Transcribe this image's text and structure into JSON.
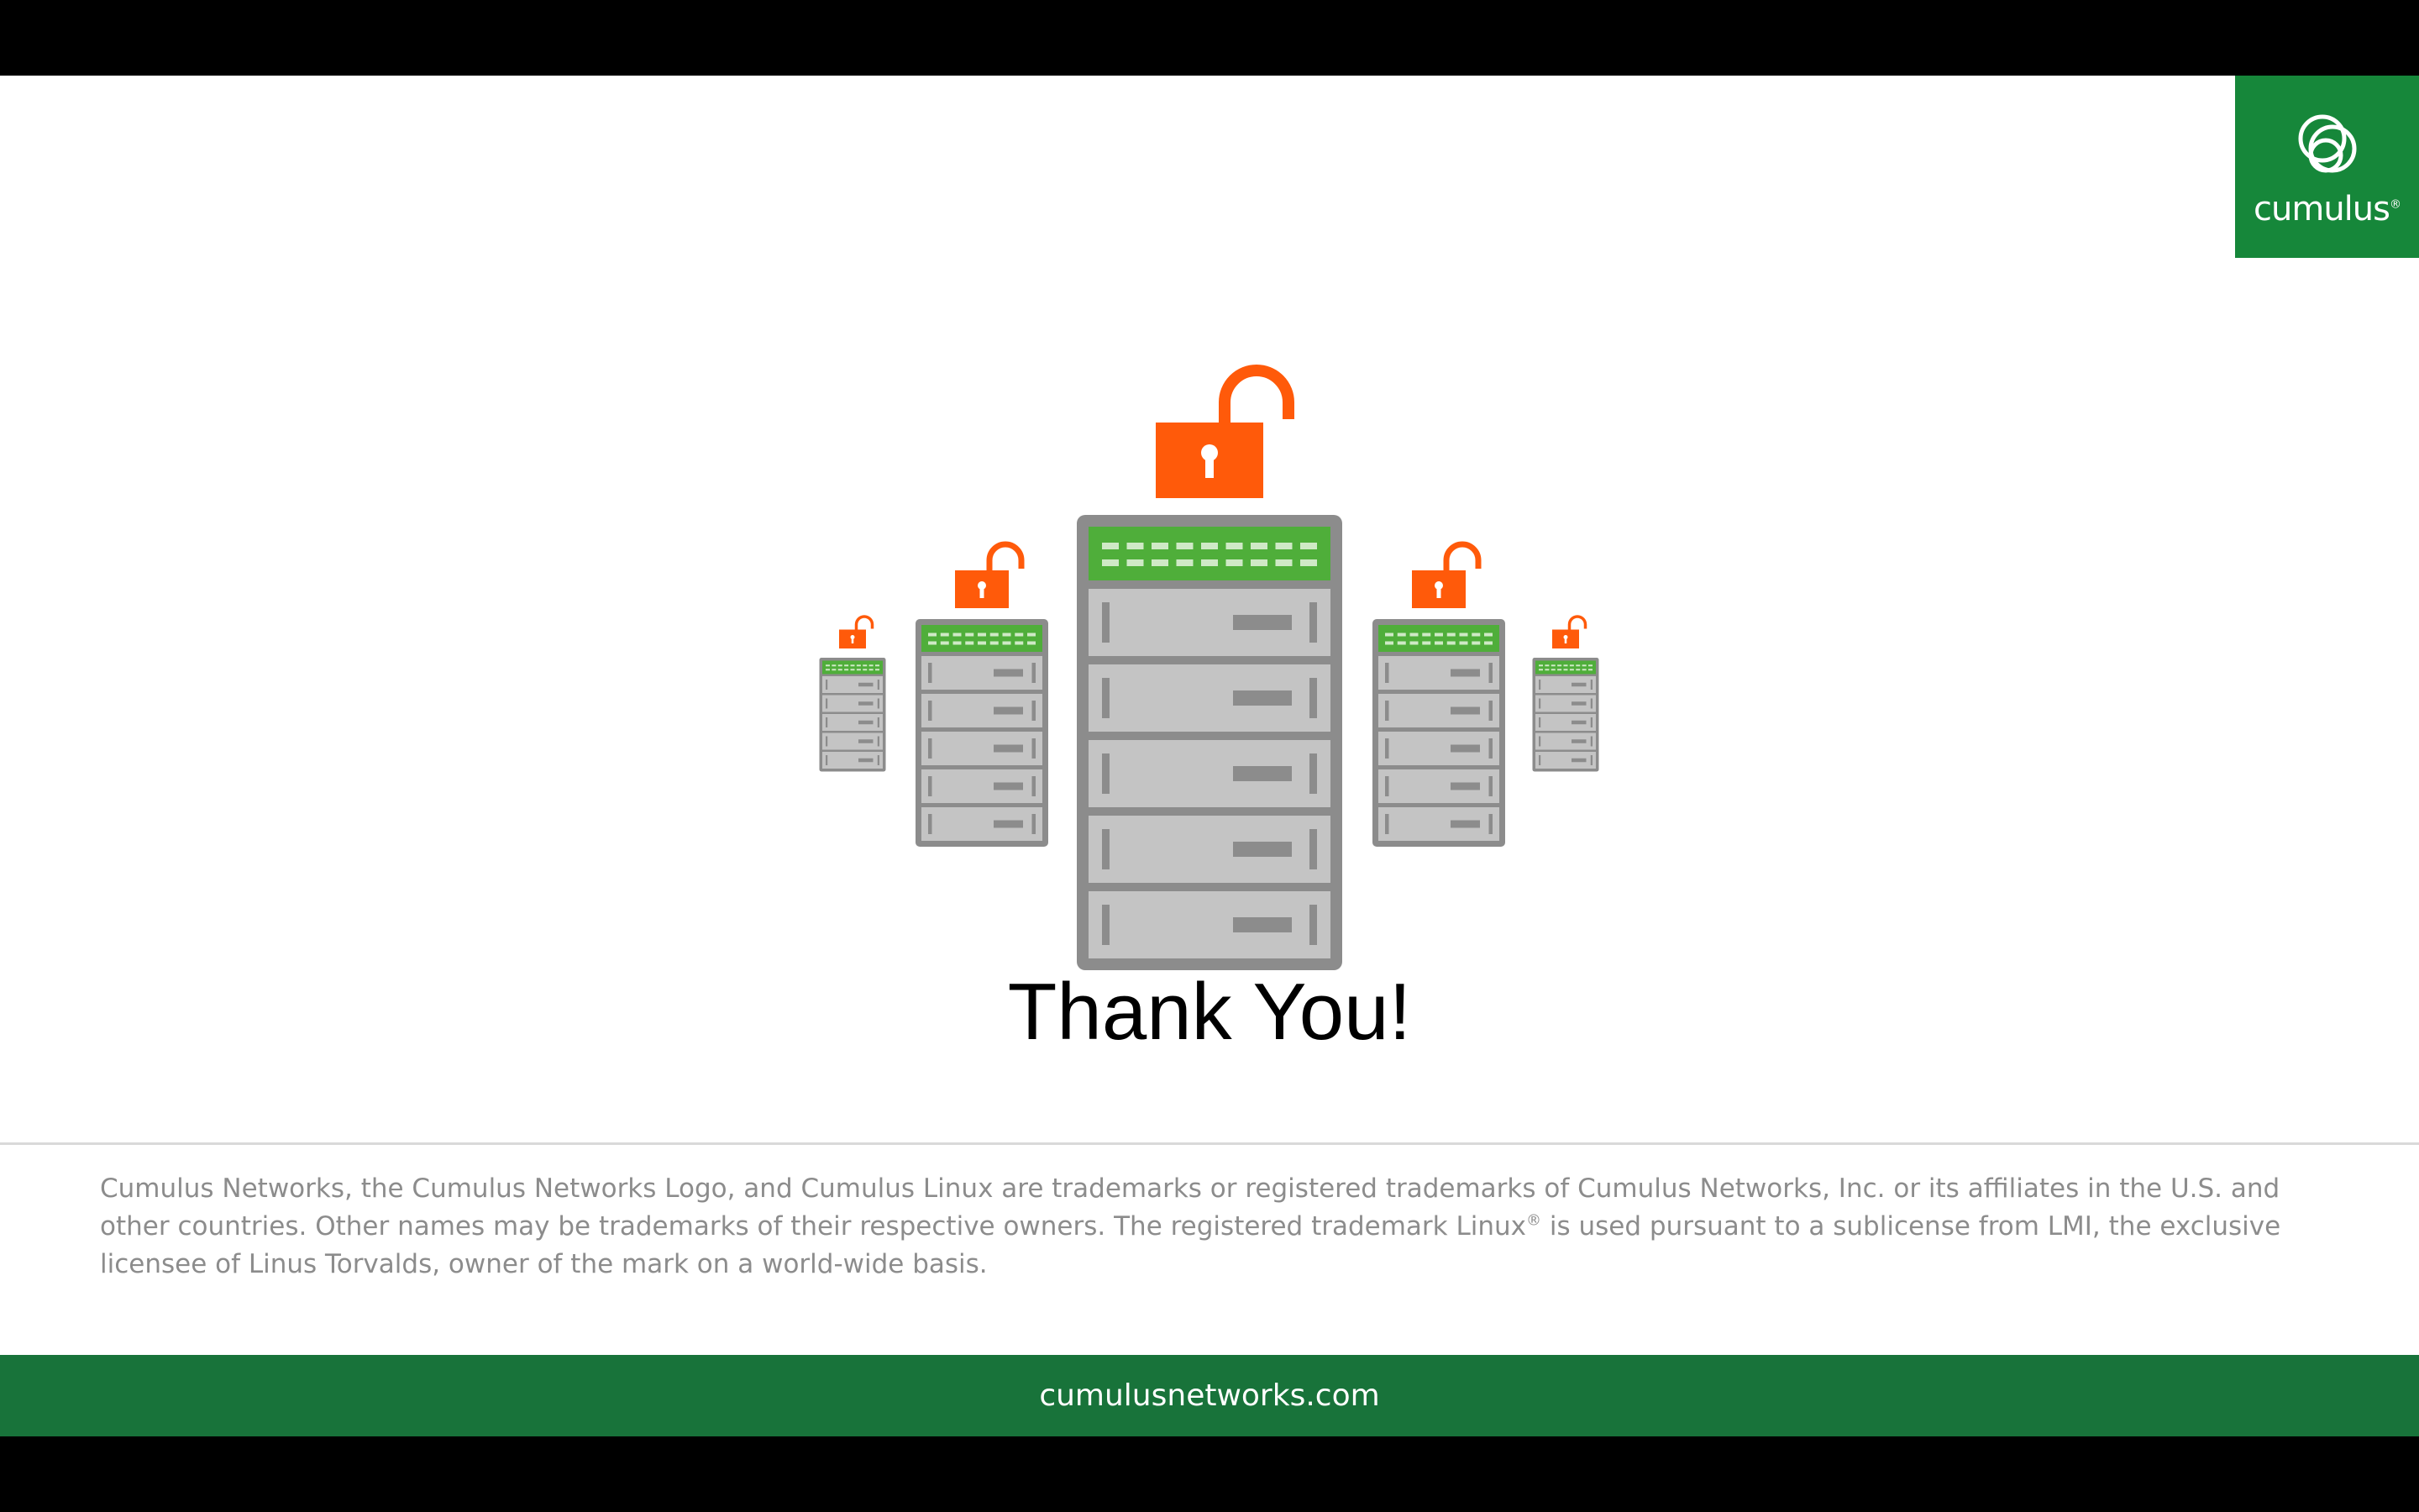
{
  "brand": {
    "logo_text": "cumulus",
    "logo_mark": "®",
    "green": "#16873a",
    "footer_green": "#18733a",
    "lock_color": "#ff5a0a",
    "server_gray": "#8c8c8c"
  },
  "slide": {
    "title": "Thank You!",
    "illustration": "servers-with-unlocked-padlocks",
    "legal": {
      "part1": "Cumulus Networks, the Cumulus Networks Logo, and Cumulus Linux are trademarks or registered trademarks of Cumulus Networks, Inc. or its affiliates in the U.S. and other countries. Other names may be trademarks of their respective owners. The registered trademark Linux",
      "mark": "®",
      "part2": " is used pursuant to a sublicense from LMI, the exclusive licensee of Linus Torvalds, owner of the mark on a world-wide basis."
    },
    "footer_url": "cumulusnetworks.com"
  }
}
